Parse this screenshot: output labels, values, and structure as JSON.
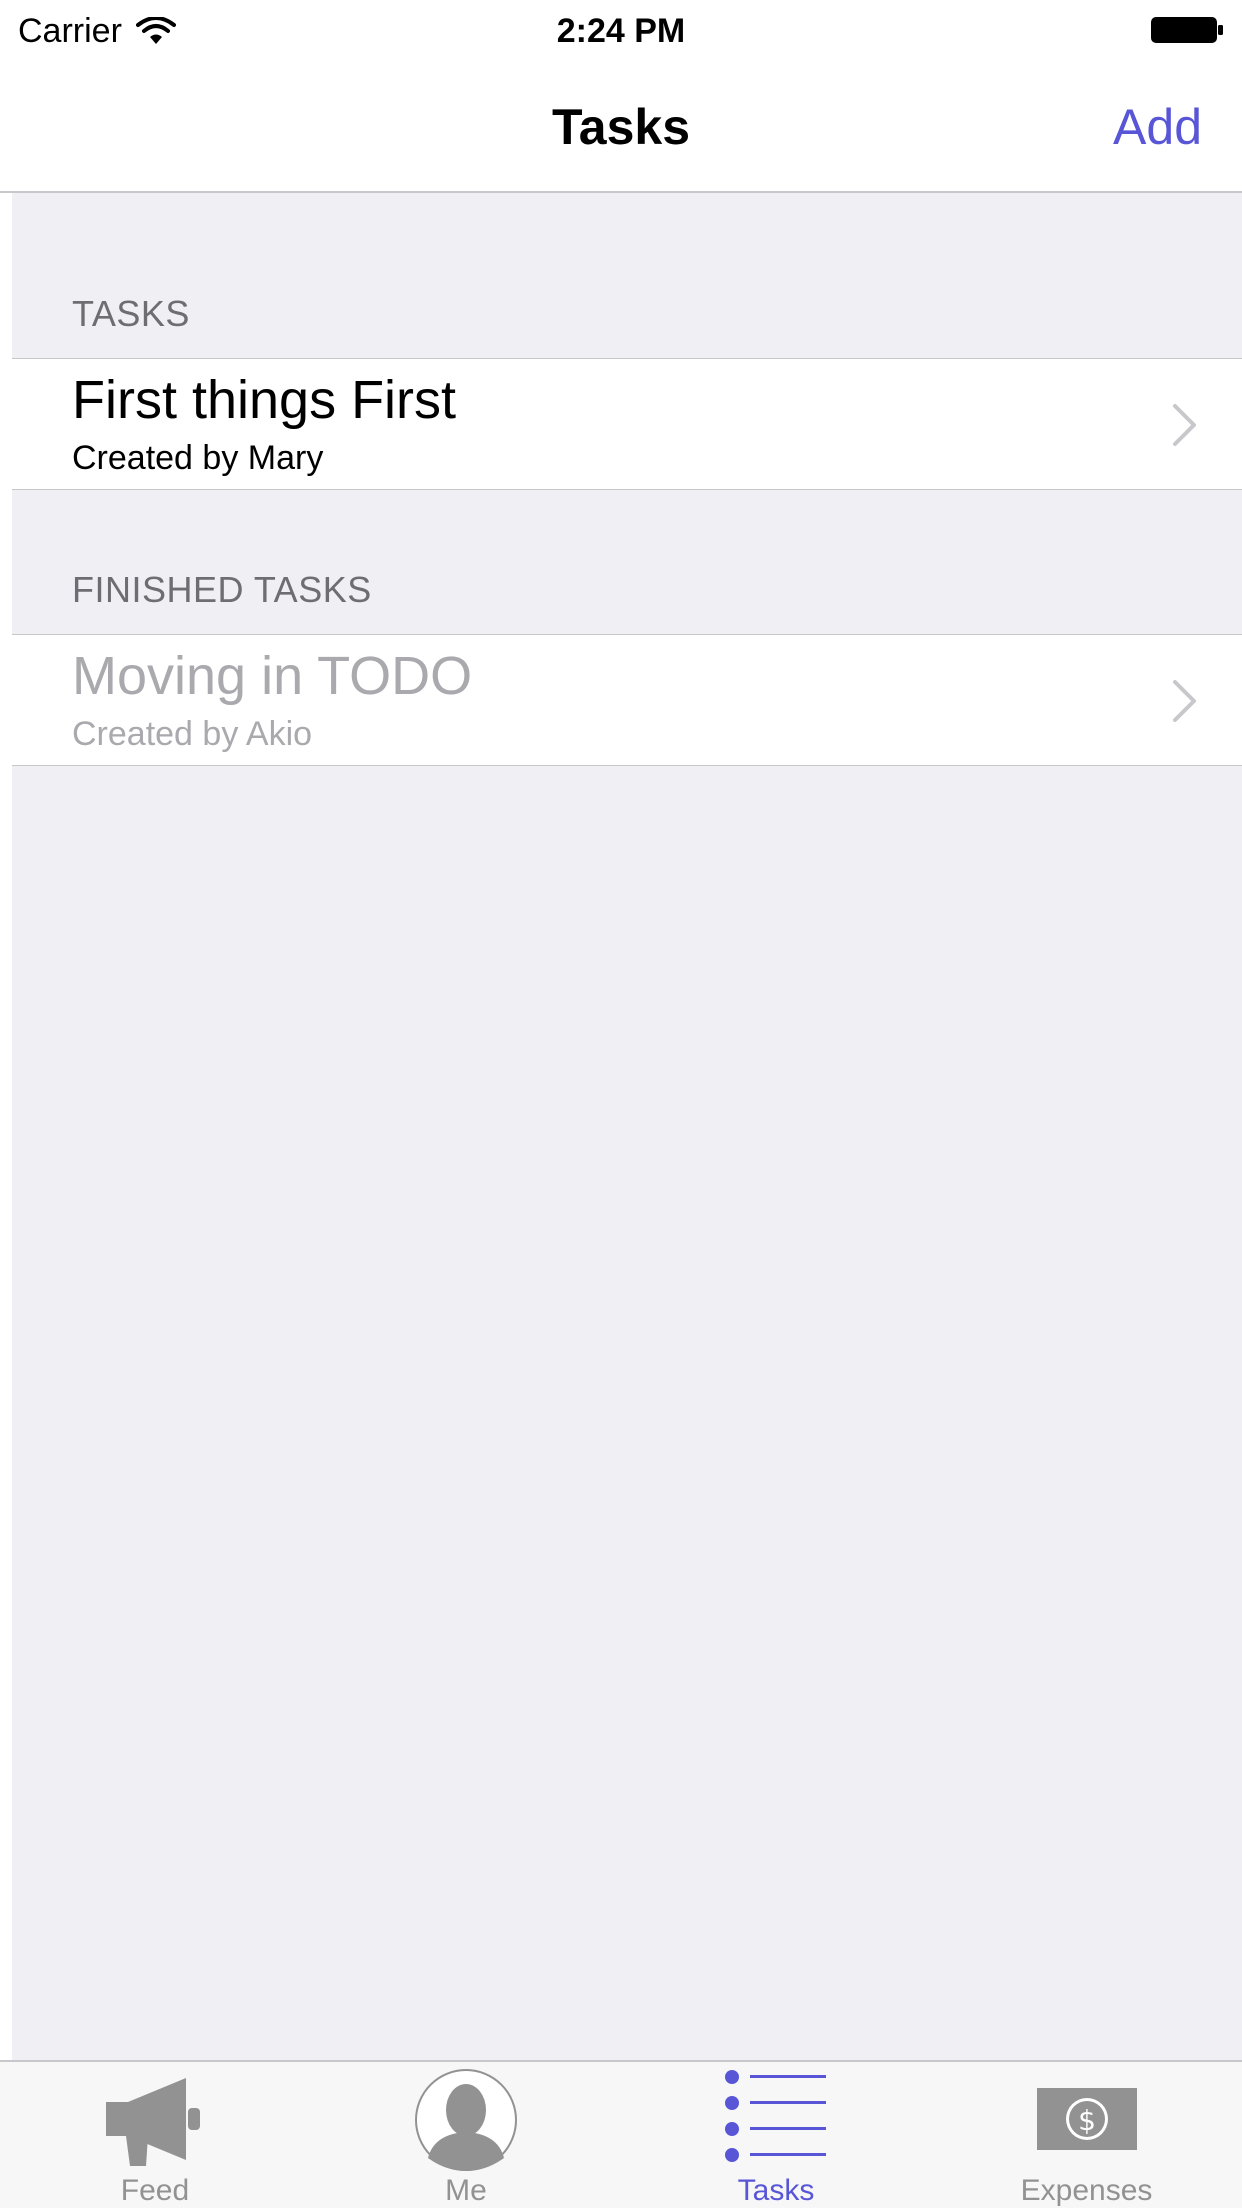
{
  "status_bar": {
    "carrier": "Carrier",
    "time": "2:24 PM",
    "wifi_icon": "wifi-icon",
    "battery_icon": "battery-icon"
  },
  "nav": {
    "title": "Tasks",
    "add_label": "Add"
  },
  "sections": [
    {
      "header": "TASKS",
      "items": [
        {
          "title": "First things First",
          "subtitle": "Created by Mary",
          "finished": false
        }
      ]
    },
    {
      "header": "FINISHED TASKS",
      "items": [
        {
          "title": "Moving in TODO",
          "subtitle": "Created by Akio",
          "finished": true
        }
      ]
    }
  ],
  "tabs": [
    {
      "label": "Feed",
      "icon": "megaphone-icon",
      "active": false
    },
    {
      "label": "Me",
      "icon": "person-icon",
      "active": false
    },
    {
      "label": "Tasks",
      "icon": "list-icon",
      "active": true
    },
    {
      "label": "Expenses",
      "icon": "dollar-bill-icon",
      "active": false
    }
  ],
  "colors": {
    "accent": "#5856d6",
    "background": "#efeff4",
    "section_header": "#6d6d72",
    "finished_text": "#a9a9ae",
    "tab_inactive": "#929292"
  }
}
